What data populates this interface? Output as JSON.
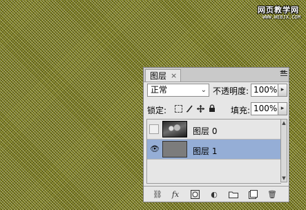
{
  "watermark": {
    "title": "网页教学网",
    "subtitle": "WWW.WEBJX.COM"
  },
  "panel": {
    "tab_label": "图层",
    "tab_close": "×",
    "collapse_glyph": "◂◂",
    "blend_mode": "正常",
    "select_arrow": "⌄",
    "opacity_label": "不透明度:",
    "opacity_value": "100%",
    "step_arrow": "▸",
    "lock_label": "锁定:",
    "fill_label": "填充:",
    "fill_value": "100%",
    "lock_icons": [
      "lock-transparent-icon",
      "lock-image-icon",
      "lock-position-icon",
      "lock-all-icon"
    ],
    "layers": [
      {
        "name": "图层 0",
        "visible": false,
        "selected": false,
        "thumbnail": "photo"
      },
      {
        "name": "图层 1",
        "visible": true,
        "selected": true,
        "thumbnail": "gray-fill",
        "eye_glyph": "👁"
      }
    ],
    "scroll_up": "▲",
    "scroll_down": "▼",
    "bottom_icons": [
      "link-icon",
      "fx-icon",
      "mask-icon",
      "adjustment-icon",
      "group-icon",
      "new-layer-icon",
      "trash-icon"
    ],
    "bottom_glyphs": {
      "link": "⛓",
      "fx": "fx",
      "adjustment": "◐",
      "trash": "🗑"
    }
  },
  "colors": {
    "selected_row": "#95aed6",
    "background_pattern": "#7b7c1a"
  }
}
